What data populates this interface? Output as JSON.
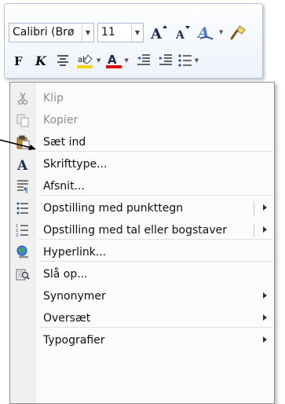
{
  "toolbar": {
    "font_name": "Calibri (Brø",
    "font_size": "11",
    "colors": {
      "highlight": "#f2d600",
      "font_color": "#e00000"
    }
  },
  "menu": {
    "items": [
      {
        "label": "Klip",
        "icon": "scissors-icon",
        "disabled": true
      },
      {
        "label": "Kopier",
        "icon": "copy-icon",
        "disabled": true
      },
      {
        "label": "Sæt ind",
        "icon": "paste-icon",
        "disabled": false
      },
      {
        "label": "Skrifttype...",
        "icon": "font-icon",
        "disabled": false
      },
      {
        "label": "Afsnit...",
        "icon": "paragraph-icon",
        "disabled": false
      },
      {
        "label": "Opstilling med punkttegn",
        "icon": "bullets-icon",
        "submenu": true
      },
      {
        "label": "Opstilling med tal eller bogstaver",
        "icon": "numbering-icon",
        "submenu": true
      },
      {
        "label": "Hyperlink...",
        "icon": "hyperlink-icon"
      },
      {
        "label": "Slå op...",
        "icon": "research-icon"
      },
      {
        "label": "Synonymer",
        "icon": "",
        "submenu": true
      },
      {
        "label": "Oversæt",
        "icon": "",
        "submenu": true
      },
      {
        "label": "Typografier",
        "icon": "",
        "submenu": true
      }
    ]
  }
}
